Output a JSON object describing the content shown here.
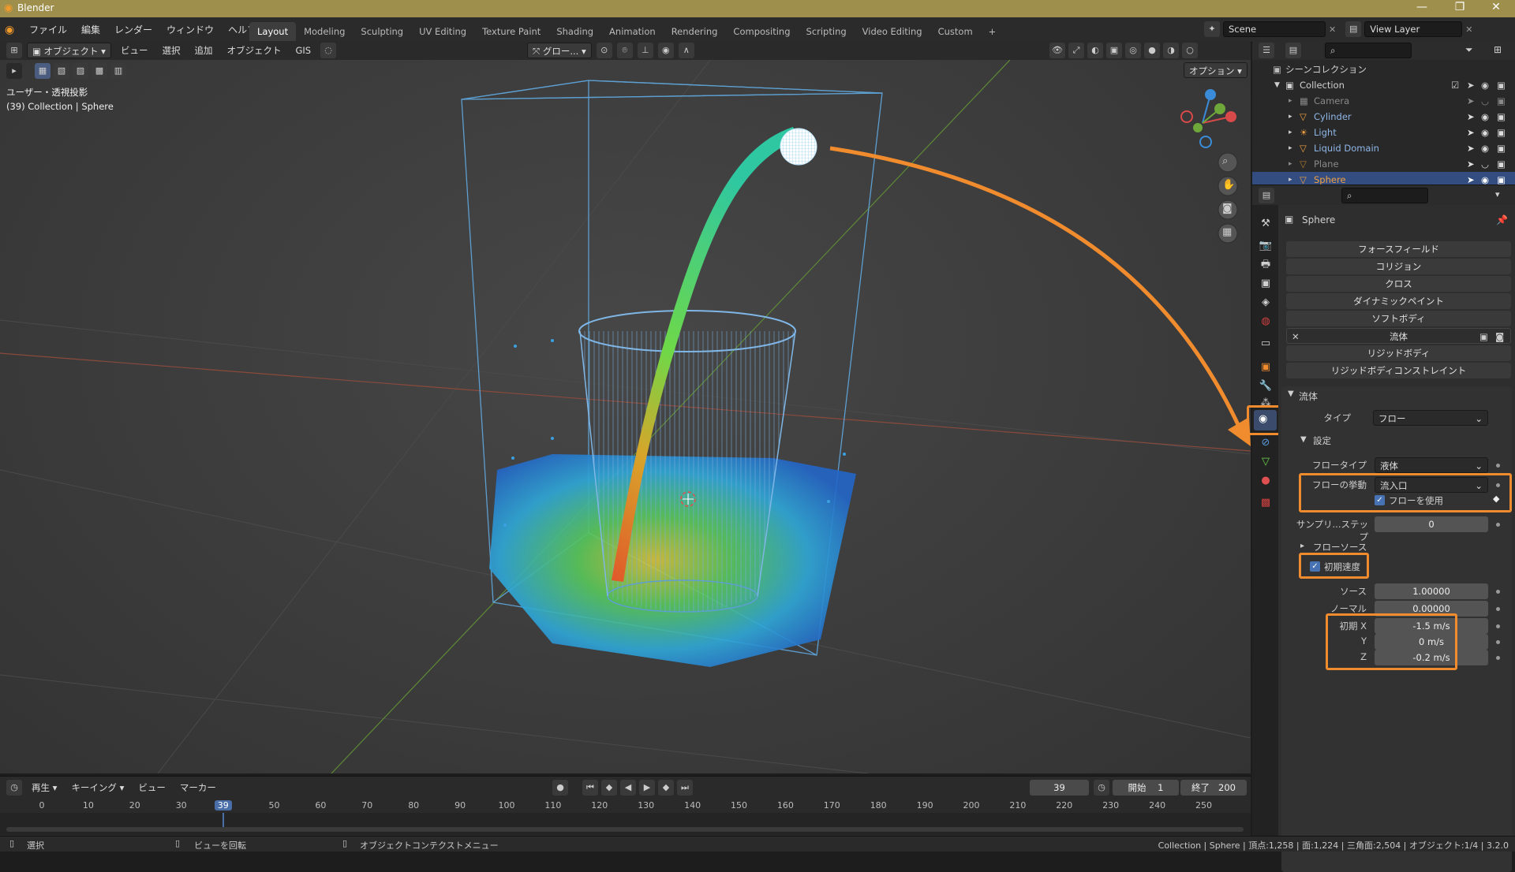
{
  "titlebar": {
    "title": "Blender",
    "min": "—",
    "max": "❐",
    "close": "✕"
  },
  "menu": [
    "ファイル",
    "編集",
    "レンダー",
    "ウィンドウ",
    "ヘルプ"
  ],
  "workspaces": [
    "Layout",
    "Modeling",
    "Sculpting",
    "UV Editing",
    "Texture Paint",
    "Shading",
    "Animation",
    "Rendering",
    "Compositing",
    "Scripting",
    "Video Editing",
    "Custom"
  ],
  "workspace_add": "+",
  "scene": "Scene",
  "view_layer": "View Layer",
  "viewport_header": {
    "mode": "オブジェクト",
    "items": [
      "ビュー",
      "選択",
      "追加",
      "オブジェクト",
      "GIS"
    ],
    "transform_orientation": "グロー...",
    "options": "オプション"
  },
  "viewport": {
    "view_label": "ユーザー・透視投影",
    "collection_label": "(39) Collection | Sphere"
  },
  "outliner": {
    "root": "シーンコレクション",
    "collection": "Collection",
    "objects": [
      {
        "name": "Camera",
        "dim": true
      },
      {
        "name": "Cylinder",
        "dim": false
      },
      {
        "name": "Light",
        "dim": false
      },
      {
        "name": "Liquid Domain",
        "dim": false
      },
      {
        "name": "Plane",
        "dim": true
      },
      {
        "name": "Sphere",
        "dim": false,
        "selected": true
      }
    ]
  },
  "properties": {
    "object_name": "Sphere",
    "physics_buttons": [
      "フォースフィールド",
      "コリジョン",
      "クロス",
      "ダイナミックペイント",
      "ソフトボディ",
      "流体",
      "リジッドボディ",
      "リジッドボディコンストレイント"
    ],
    "fluid_panel": "流体",
    "type_label": "タイプ",
    "type_value": "フロー",
    "settings_label": "設定",
    "flow_type_label": "フロータイプ",
    "flow_type_value": "液体",
    "flow_behavior_label": "フローの挙動",
    "flow_behavior_value": "流入口",
    "use_flow_label": "フローを使用",
    "subframes_label": "サンプリ...ステップ",
    "subframes_value": "0",
    "flow_source_label": "フローソース",
    "initial_velocity_label": "初期速度",
    "source_label": "ソース",
    "source_value": "1.00000",
    "normal_label": "ノーマル",
    "normal_value": "0.00000",
    "init_x_label": "初期 X",
    "init_x_value": "-1.5 m/s",
    "y_label": "Y",
    "y_value": "0 m/s",
    "z_label": "Z",
    "z_value": "-0.2 m/s"
  },
  "timeline": {
    "playback": "再生",
    "keying": "キーイング",
    "view": "ビュー",
    "marker": "マーカー",
    "current_frame": "39",
    "start_label": "開始",
    "start_value": "1",
    "end_label": "終了",
    "end_value": "200",
    "ticks": [
      "0",
      "10",
      "20",
      "30",
      "39",
      "50",
      "60",
      "70",
      "80",
      "90",
      "100",
      "110",
      "120",
      "130",
      "140",
      "150",
      "160",
      "170",
      "180",
      "190",
      "200",
      "210",
      "220",
      "230",
      "240",
      "250"
    ]
  },
  "status": {
    "select": "選択",
    "rotate": "ビューを回転",
    "context": "オブジェクトコンテクストメニュー",
    "stats": "Collection | Sphere | 頂点:1,258 | 面:1,224 | 三角面:2,504 | オブジェクト:1/4 | 3.2.0"
  },
  "colors": {
    "accent": "#f08c2e",
    "selection": "#334d80",
    "titlebar": "#9f8f4c"
  }
}
